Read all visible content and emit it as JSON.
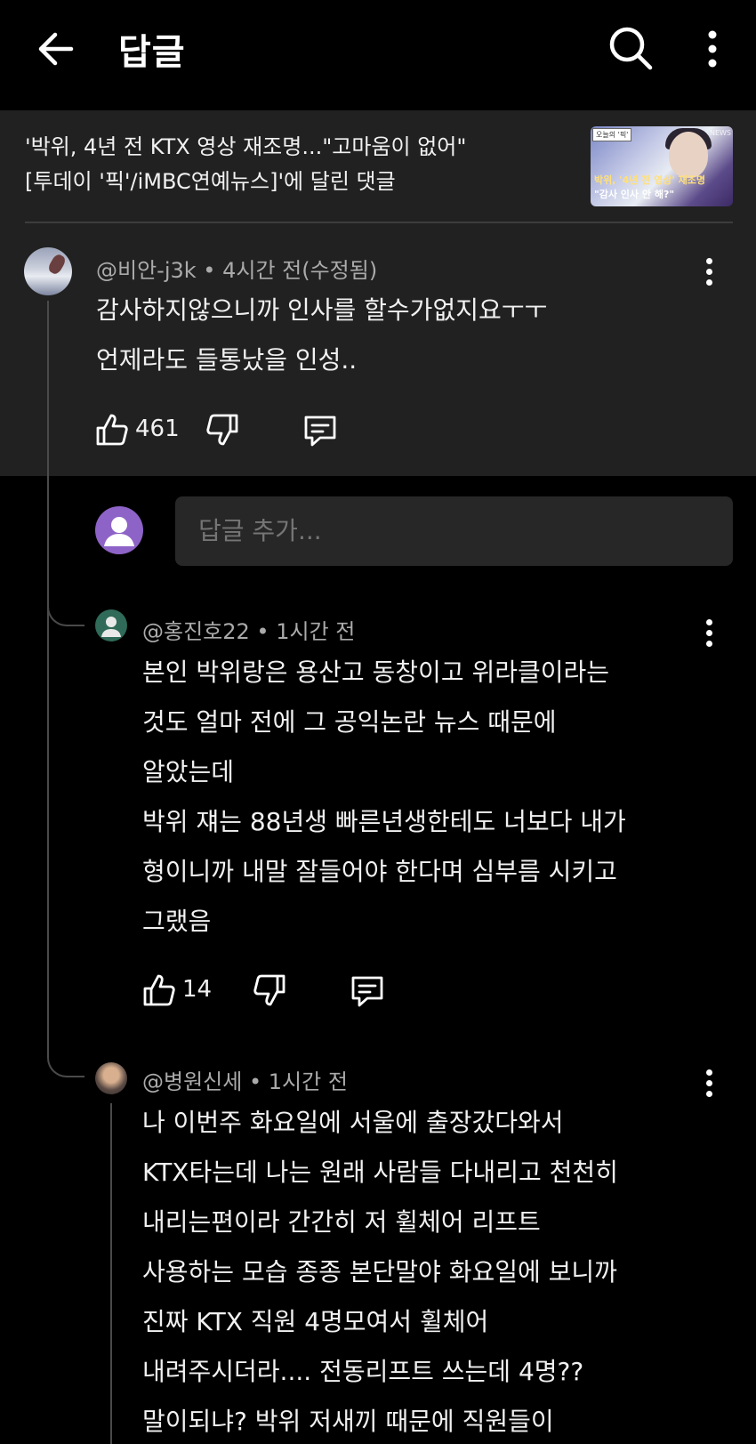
{
  "appbar": {
    "title": "답글"
  },
  "video": {
    "title_line1": "'박위, 4년 전 KTX 영상 재조명...\"고마움이 없어\"",
    "title_line2": "[투데이 '픽'/iMBC연예뉴스]'에 달린 댓글",
    "thumb": {
      "tag": "오늘의 '픽'",
      "brand": "NEWS",
      "caption1": "박위, '4년 전 영상' 재조명",
      "caption2": "\"감사 인사 안 해?\""
    }
  },
  "main_comment": {
    "author": "@비안-j3k",
    "time": "4시간 전(수정됨)",
    "lines": [
      "감사하지않으니까 인사를 할수가없지요ㅜㅜ",
      "언제라도 들통났을 인성.."
    ],
    "likes": "461"
  },
  "reply_input": {
    "placeholder": "답글 추가..."
  },
  "replies": [
    {
      "author": "@홍진호22",
      "time": "1시간 전",
      "lines": [
        "본인 박위랑은 용산고 동창이고 위라클이라는",
        "것도 얼마 전에 그 공익논란 뉴스 때문에",
        "알았는데",
        "박위 쟤는 88년생 빠른년생한테도 너보다 내가",
        "형이니까 내말 잘들어야 한다며 심부름 시키고",
        "그랬음"
      ],
      "likes": "14"
    },
    {
      "author": "@병원신세",
      "time": "1시간 전",
      "lines": [
        "나 이번주 화요일에 서울에 출장갔다와서",
        "KTX타는데 나는 원래 사람들 다내리고 천천히",
        "내리는편이라 간간히 저 휠체어 리프트",
        "사용하는 모습 종종 본단말야 화요일에 보니까",
        "진짜 KTX 직원 4명모여서 휠체어",
        "내려주시더라.... 전동리프트 쓰는데 4명??",
        "말이되냐? 박위 저새끼 때문에  직원들이"
      ]
    }
  ]
}
